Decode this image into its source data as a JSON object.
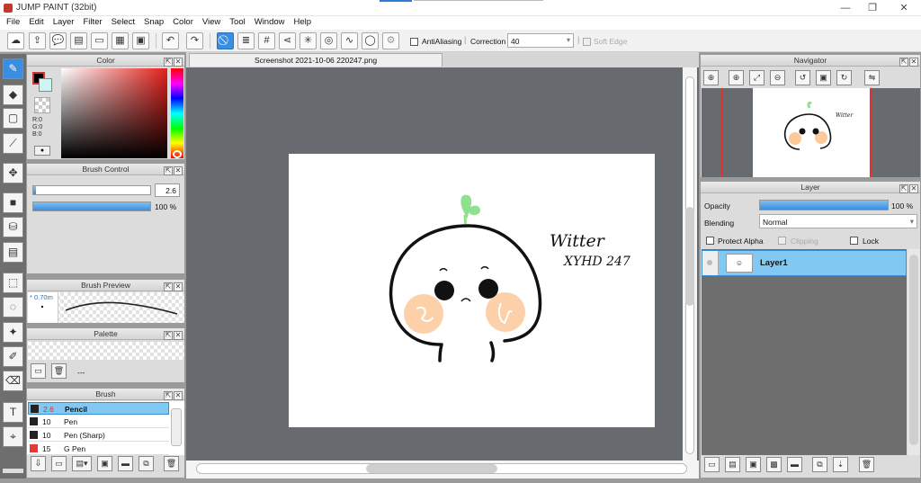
{
  "app": {
    "title": "JUMP PAINT (32bit)"
  },
  "window_controls": {
    "minimize": "—",
    "restore": "❐",
    "close": "✕"
  },
  "menu": [
    "File",
    "Edit",
    "Layer",
    "Filter",
    "Select",
    "Snap",
    "Color",
    "View",
    "Tool",
    "Window",
    "Help"
  ],
  "toolbar": {
    "antialiasing_label": "AntiAliasing",
    "antialiasing_checked": true,
    "correction_label": "Correction",
    "correction_value": "40",
    "soft_edge_label": "Soft Edge",
    "soft_edge_checked": false
  },
  "color_panel": {
    "title": "Color",
    "r_label": "R:0",
    "g_label": "G:0",
    "b_label": "B:0",
    "primary_color": "#000000",
    "secondary_color": "#ffffff"
  },
  "brush_control": {
    "title": "Brush Control",
    "size_value": "2.6",
    "size_fraction": 0.02,
    "opacity_value": "100",
    "opacity_unit": "%",
    "opacity_fraction": 1.0
  },
  "brush_preview": {
    "title": "Brush Preview",
    "size_label": "* 0.70m"
  },
  "palette": {
    "title": "Palette",
    "name": "---"
  },
  "brush_list": {
    "title": "Brush",
    "items": [
      {
        "size": "2.6",
        "name": "Pencil",
        "selected": true,
        "color": "#222222"
      },
      {
        "size": "10",
        "name": "Pen",
        "selected": false,
        "color": "#222222"
      },
      {
        "size": "10",
        "name": "Pen (Sharp)",
        "selected": false,
        "color": "#222222"
      },
      {
        "size": "15",
        "name": "G Pen",
        "selected": false,
        "color": "#e53935"
      }
    ]
  },
  "document": {
    "tab": "Screenshot 2021-10-06 220247.png"
  },
  "drawing": {
    "signature_line1": "Witter",
    "signature_line2": "XYHD 247"
  },
  "navigator": {
    "title": "Navigator"
  },
  "layer_panel": {
    "title": "Layer",
    "opacity_label": "Opacity",
    "opacity_value": "100",
    "opacity_unit": "%",
    "opacity_fraction": 1.0,
    "blending_label": "Blending",
    "blending_value": "Normal",
    "protect_alpha_label": "Protect Alpha",
    "clipping_label": "Clipping",
    "lock_label": "Lock",
    "layers": [
      {
        "name": "Layer1",
        "selected": true
      }
    ]
  },
  "colors": {
    "accent": "#3b8de0",
    "selection": "#81c9f2",
    "canvas_bg": "#676a6f"
  }
}
